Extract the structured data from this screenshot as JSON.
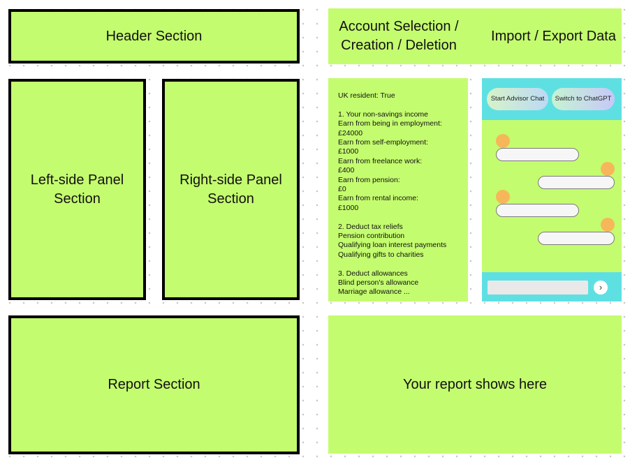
{
  "wireframe": {
    "header": "Header Section",
    "left_panel": "Left-side Panel Section",
    "right_panel": "Right-side Panel Section",
    "report": "Report Section"
  },
  "mockup": {
    "header": {
      "account": "Account Selection / Creation / Deletion",
      "import_export": "Import / Export Data"
    },
    "left_panel_lines": [
      "UK resident: True",
      "",
      "1. Your non-savings income",
      "Earn from being in employment:",
      "£24000",
      "Earn from self-employment:",
      "£1000",
      "Earn from freelance work:",
      "£400",
      "Earn from pension:",
      "£0",
      "Earn from rental income:",
      "£1000",
      "",
      "2. Deduct tax reliefs",
      "Pension contribution",
      "Qualifying loan interest payments",
      "Qualifying gifts to charities",
      "",
      "3. Deduct allowances",
      "Blind person's allowance",
      "Marriage allowance ..."
    ],
    "chat": {
      "advisor_button": "Start Advisor Chat",
      "chatgpt_button": "Switch to ChatGPT",
      "send_icon": "›"
    },
    "report": "Your report shows here"
  },
  "colors": {
    "panel_green": "#c4fc6f",
    "chat_cyan": "#5ee0e3",
    "avatar_orange": "#f6b75a"
  }
}
